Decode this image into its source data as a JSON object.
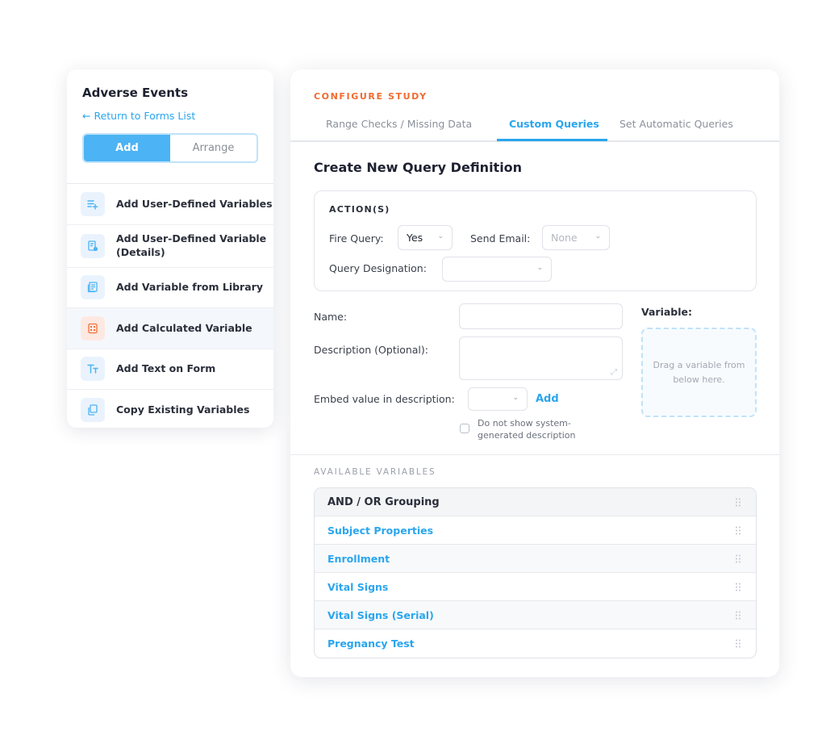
{
  "sidebar": {
    "title": "Adverse Events",
    "back_link": "← Return to Forms List",
    "segments": {
      "add": "Add",
      "arrange": "Arrange"
    },
    "items": [
      {
        "label": "Add User-Defined Variables",
        "icon": "list-add-icon"
      },
      {
        "label": "Add User-Defined Variable (Details)",
        "icon": "document-settings-icon"
      },
      {
        "label": "Add Variable from Library",
        "icon": "library-icon"
      },
      {
        "label": "Add Calculated Variable",
        "icon": "calculator-icon"
      },
      {
        "label": "Add Text on Form",
        "icon": "text-icon"
      },
      {
        "label": "Copy Existing Variables",
        "icon": "copy-icon"
      }
    ]
  },
  "main": {
    "eyebrow": "CONFIGURE STUDY",
    "tabs": [
      {
        "label": "Range Checks / Missing Data"
      },
      {
        "label": "Custom Queries"
      },
      {
        "label": "Set Automatic Queries"
      }
    ],
    "heading": "Create New Query Definition",
    "actions": {
      "title": "ACTION(S)",
      "fire_query_label": "Fire Query:",
      "fire_query_value": "Yes",
      "send_email_label": "Send Email:",
      "send_email_value": "None",
      "designation_label": "Query Designation:",
      "designation_value": ""
    },
    "form": {
      "name_label": "Name:",
      "name_value": "",
      "description_label": "Description (Optional):",
      "description_value": "",
      "embed_label": "Embed value in description:",
      "embed_value": "",
      "add_label": "Add",
      "checkbox_label": "Do not show system-generated description",
      "variable_label": "Variable:",
      "dropzone_text": "Drag a variable from below here."
    },
    "available": {
      "title": "AVAILABLE VARIABLES",
      "rows": [
        {
          "label": "AND / OR Grouping"
        },
        {
          "label": "Subject Properties"
        },
        {
          "label": "Enrollment"
        },
        {
          "label": "Vital Signs"
        },
        {
          "label": "Vital Signs (Serial)"
        },
        {
          "label": "Pregnancy Test"
        }
      ]
    }
  },
  "colors": {
    "accent": "#2aa6ee",
    "accent_fill": "#4cb3f4",
    "eyebrow": "#f26a2e",
    "calc_icon": "#f0703a"
  }
}
